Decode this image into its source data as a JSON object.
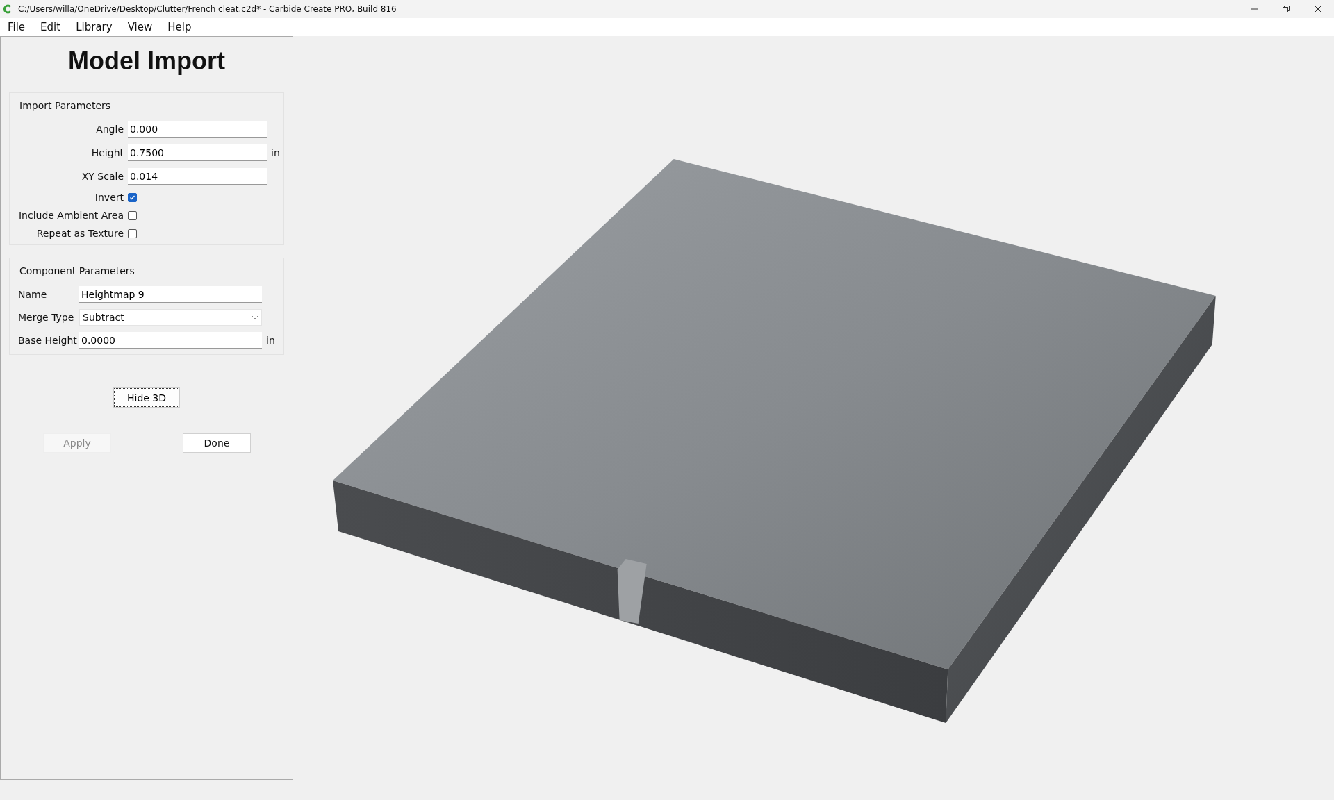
{
  "window": {
    "title": "C:/Users/willa/OneDrive/Desktop/Clutter/French cleat.c2d* - Carbide Create PRO, Build 816"
  },
  "menu": [
    "File",
    "Edit",
    "Library",
    "View",
    "Help"
  ],
  "panel": {
    "title": "Model Import",
    "import_parameters": {
      "heading": "Import Parameters",
      "fields": [
        {
          "kind": "text",
          "label": "Angle",
          "value": "0.000"
        },
        {
          "kind": "text",
          "label": "Height",
          "value": "0.7500",
          "unit": "in"
        },
        {
          "kind": "text",
          "label": "XY Scale",
          "value": "0.014"
        },
        {
          "kind": "checkbox",
          "label": "Invert",
          "checked": true
        },
        {
          "kind": "checkbox",
          "label": "Include Ambient Area",
          "checked": false
        },
        {
          "kind": "checkbox",
          "label": "Repeat as Texture",
          "checked": false
        }
      ]
    },
    "component_parameters": {
      "heading": "Component Parameters",
      "fields": [
        {
          "kind": "text",
          "label": "Name",
          "value": "Heightmap 9"
        },
        {
          "kind": "dropdown",
          "label": "Merge Type",
          "value": "Subtract"
        },
        {
          "kind": "text",
          "label": "Base Height",
          "value": "0.0000",
          "unit": "in"
        }
      ]
    },
    "hide_3d_button": "Hide 3D",
    "buttons": [
      {
        "label": "Apply",
        "disabled": true
      },
      {
        "label": "Done",
        "disabled": false
      }
    ]
  }
}
